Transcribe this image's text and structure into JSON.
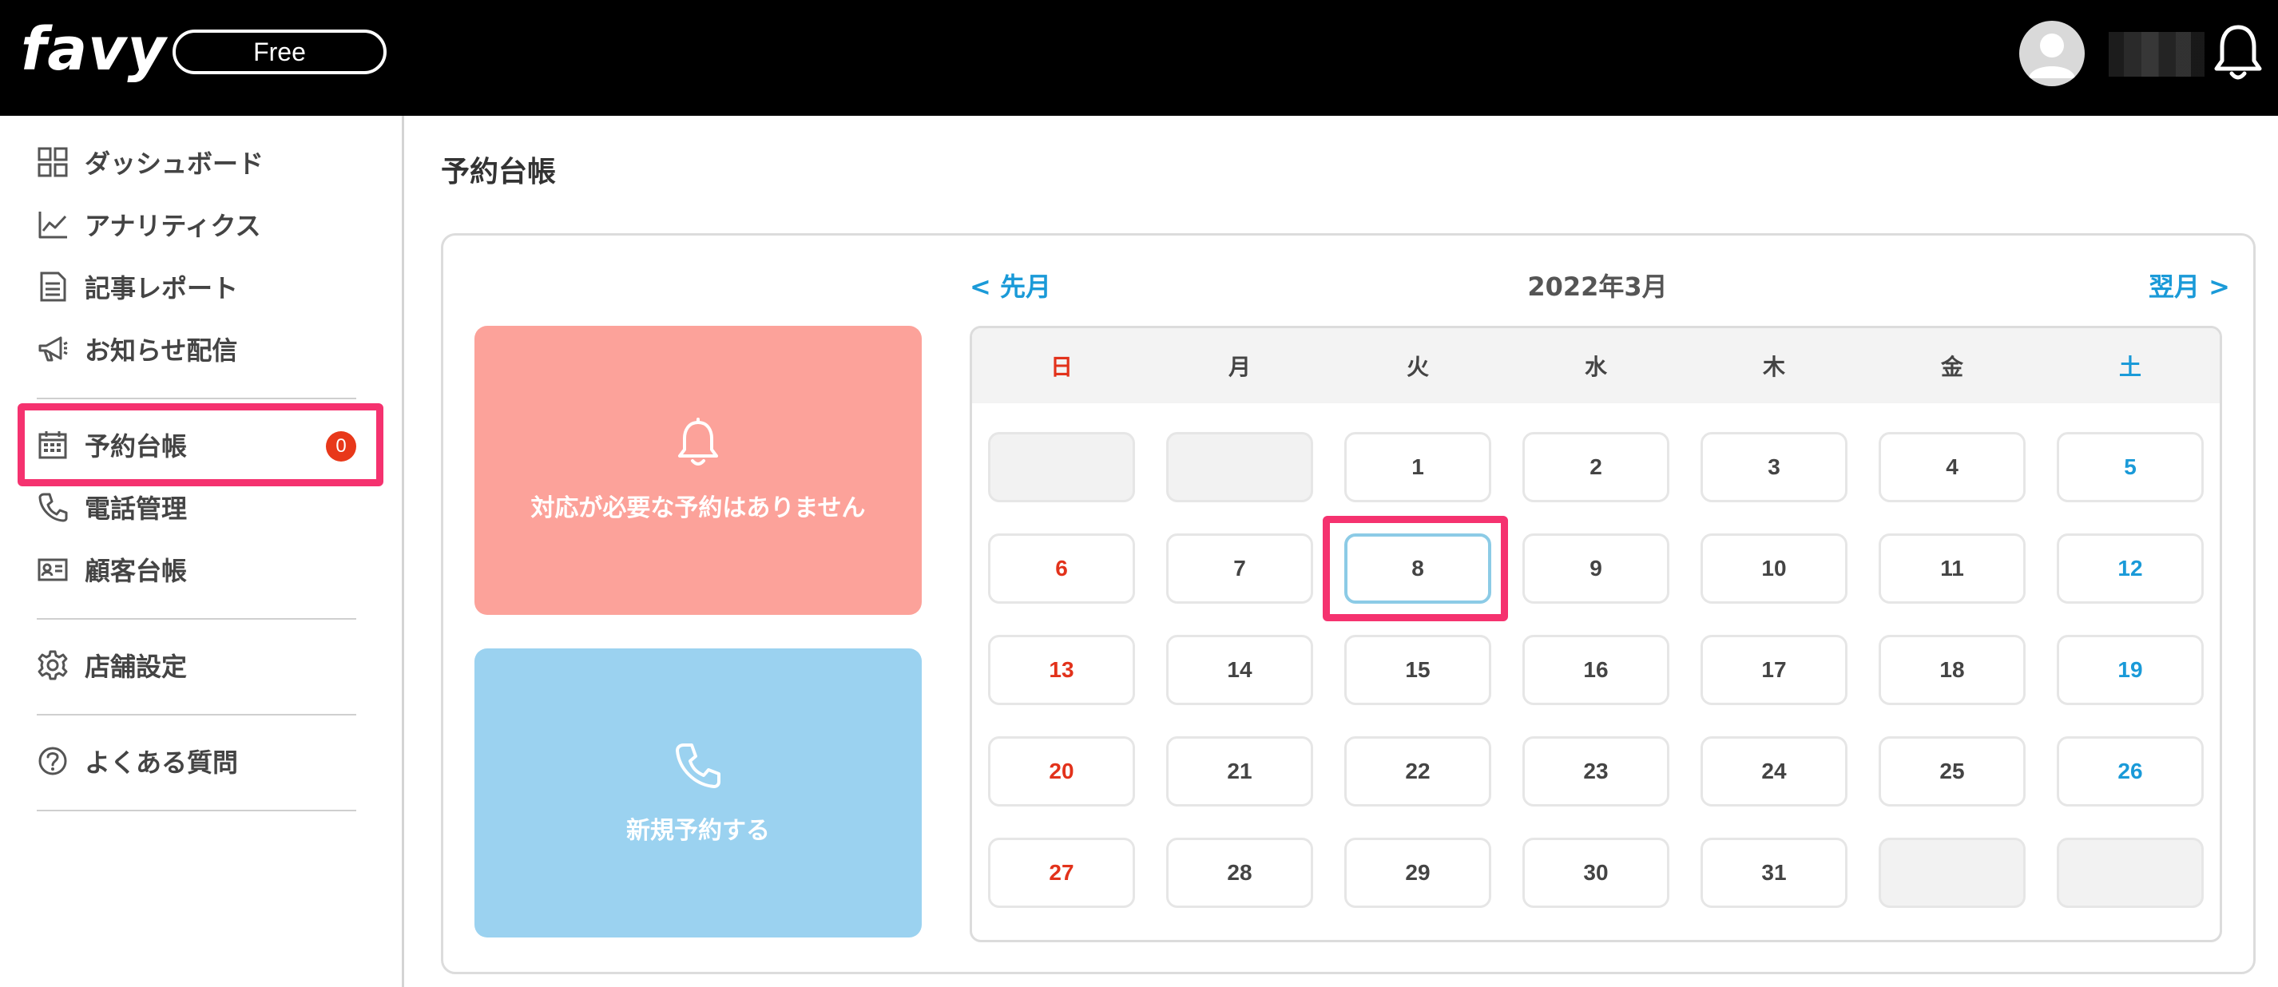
{
  "header": {
    "logo_text": "favy",
    "plan_label": "Free",
    "user_name": ""
  },
  "sidebar": {
    "items": [
      {
        "label": "ダッシュボード",
        "icon": "grid-icon"
      },
      {
        "label": "アナリティクス",
        "icon": "chart-line-icon"
      },
      {
        "label": "記事レポート",
        "icon": "document-icon"
      },
      {
        "label": "お知らせ配信",
        "icon": "megaphone-icon"
      },
      {
        "label": "予約台帳",
        "icon": "calendar-icon",
        "badge": "0",
        "selected": true
      },
      {
        "label": "電話管理",
        "icon": "phone-icon"
      },
      {
        "label": "顧客台帳",
        "icon": "id-card-icon"
      },
      {
        "label": "店舗設定",
        "icon": "gear-icon"
      },
      {
        "label": "よくある質問",
        "icon": "question-circle-icon"
      }
    ]
  },
  "main": {
    "page_title": "予約台帳",
    "notice_card": {
      "label": "対応が必要な予約はありません",
      "icon": "bell-icon"
    },
    "new_card": {
      "label": "新規予約する",
      "icon": "phone-icon"
    },
    "calendar": {
      "prev_label": "< 先月",
      "next_label": "翌月 >",
      "month_title": "2022年3月",
      "weekdays": [
        "日",
        "月",
        "火",
        "水",
        "木",
        "金",
        "土"
      ],
      "weeks": [
        [
          "",
          "",
          "1",
          "2",
          "3",
          "4",
          "5"
        ],
        [
          "6",
          "7",
          "8",
          "9",
          "10",
          "11",
          "12"
        ],
        [
          "13",
          "14",
          "15",
          "16",
          "17",
          "18",
          "19"
        ],
        [
          "20",
          "21",
          "22",
          "23",
          "24",
          "25",
          "26"
        ],
        [
          "27",
          "28",
          "29",
          "30",
          "31",
          "",
          ""
        ]
      ],
      "today": "8"
    }
  },
  "colors": {
    "accent_blue": "#1a9ad8",
    "sunday_red": "#e2321b",
    "highlight_pink": "#f5326f",
    "notice_card_bg": "#fca29a",
    "new_card_bg": "#9bd2f0",
    "badge_red": "#e8381a"
  }
}
